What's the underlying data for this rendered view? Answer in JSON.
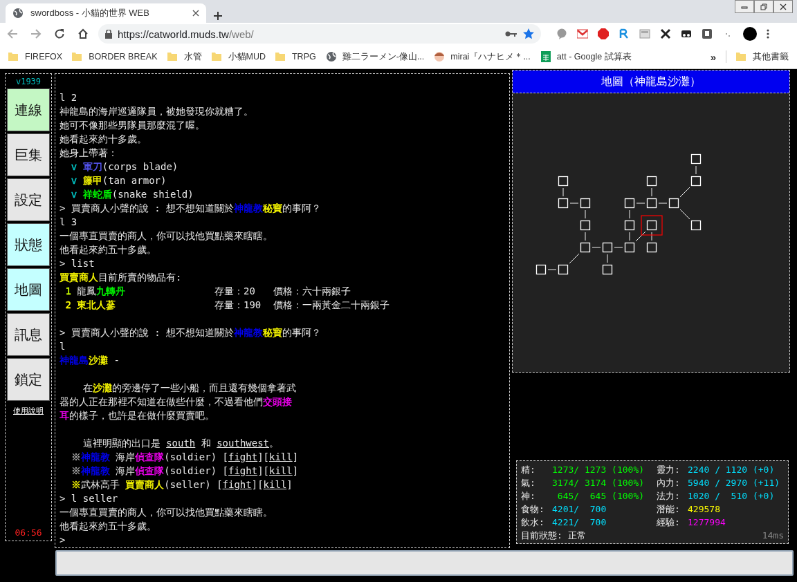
{
  "browser": {
    "tab_title": "swordboss - 小貓的世界 WEB",
    "url_host": "https://catworld.muds.tw",
    "url_path": "/web/",
    "bookmarks": [
      {
        "label": "FIREFOX",
        "kind": "folder"
      },
      {
        "label": "BORDER BREAK",
        "kind": "folder"
      },
      {
        "label": "水管",
        "kind": "folder"
      },
      {
        "label": "小貓MUD",
        "kind": "folder"
      },
      {
        "label": "TRPG",
        "kind": "folder"
      },
      {
        "label": "雞二ラーメン-像山...",
        "kind": "globe"
      },
      {
        "label": "mirai『ハナヒメ＊...",
        "kind": "avatar"
      },
      {
        "label": "att - Google 試算表",
        "kind": "sheet"
      }
    ],
    "more": "»",
    "other_bookmarks": "其他書籤"
  },
  "sidebar": {
    "version": "v1939",
    "buttons": [
      {
        "label": "連線",
        "color": "#c4f7c4"
      },
      {
        "label": "巨集",
        "color": "#e6e6e6"
      },
      {
        "label": "設定",
        "color": "#e6e6e6"
      },
      {
        "label": "狀態",
        "color": "#c4ffff"
      },
      {
        "label": "地圖",
        "color": "#c4ffff"
      },
      {
        "label": "訊息",
        "color": "#e6e6e6"
      },
      {
        "label": "鎖定",
        "color": "#e6e6e6"
      }
    ],
    "help": "使用說明",
    "clock": "06:56"
  },
  "terminal": {
    "lines": [
      {
        "kind": "text",
        "segments": [
          {
            "text": "l 2"
          }
        ]
      },
      {
        "kind": "text",
        "segments": [
          {
            "text": "神龍島的海岸巡邏隊員，被她發現你就糟了。"
          }
        ]
      },
      {
        "kind": "text",
        "segments": [
          {
            "text": "她可不像那些男隊員那麼混了喔。"
          }
        ]
      },
      {
        "kind": "text",
        "segments": [
          {
            "text": "她看起來約十多歲。"
          }
        ]
      },
      {
        "kind": "text",
        "segments": [
          {
            "text": "她身上帶著："
          }
        ]
      },
      {
        "kind": "text",
        "segments": [
          {
            "text": "  v ",
            "color": "#00c8c8"
          },
          {
            "text": "軍刀",
            "color": "#5a5aff"
          },
          {
            "text": "(corps blade)"
          }
        ]
      },
      {
        "kind": "text",
        "segments": [
          {
            "text": "  v ",
            "color": "#00c8c8"
          },
          {
            "text": "籐甲",
            "color": "#ffff00"
          },
          {
            "text": "(tan armor)"
          }
        ]
      },
      {
        "kind": "text",
        "segments": [
          {
            "text": "  v ",
            "color": "#00c8c8"
          },
          {
            "text": "祥蛇盾",
            "color": "#00ff00"
          },
          {
            "text": "(snake shield)"
          }
        ]
      },
      {
        "kind": "text",
        "segments": [
          {
            "text": "> 買賣商人小聲的說 : 想不想知道關於"
          },
          {
            "text": "神龍教",
            "color": "#0000ff"
          },
          {
            "text": "秘寶",
            "color": "#ffff00"
          },
          {
            "text": "的事阿？"
          }
        ]
      },
      {
        "kind": "text",
        "segments": [
          {
            "text": "l 3"
          }
        ]
      },
      {
        "kind": "text",
        "segments": [
          {
            "text": "一個專直買賣的商人，你可以找他買點藥來瞎瞎。"
          }
        ]
      },
      {
        "kind": "text",
        "segments": [
          {
            "text": "他看起來約五十多歲。"
          }
        ]
      },
      {
        "kind": "text",
        "segments": [
          {
            "text": "> list"
          }
        ]
      },
      {
        "kind": "text",
        "segments": [
          {
            "text": "買賣商人",
            "color": "#ffff00"
          },
          {
            "text": "目前所賣的物品有:"
          }
        ]
      },
      {
        "kind": "shop",
        "segments": [
          {
            "text": " 1 ",
            "color": "#c8ff00"
          },
          {
            "text": "龍鳳"
          },
          {
            "text": "九轉丹",
            "color": "#00ff00"
          }
        ],
        "stock": "存量：20",
        "price": "價格：六十兩銀子"
      },
      {
        "kind": "shop",
        "segments": [
          {
            "text": " 2 ",
            "color": "#ffff00"
          },
          {
            "text": "東北人蔘",
            "color": "#ffff00"
          }
        ],
        "stock": "存量：190",
        "price": "價格：一兩黃金二十兩銀子"
      },
      {
        "kind": "blank"
      },
      {
        "kind": "text",
        "segments": [
          {
            "text": "> 買賣商人小聲的說 : 想不想知道關於"
          },
          {
            "text": "神龍教",
            "color": "#0000ff"
          },
          {
            "text": "秘寶",
            "color": "#ffff00"
          },
          {
            "text": "的事阿？"
          }
        ]
      },
      {
        "kind": "text",
        "segments": [
          {
            "text": "l"
          }
        ]
      },
      {
        "kind": "text",
        "segments": [
          {
            "text": "神龍島",
            "color": "#0000ff"
          },
          {
            "text": "沙灘",
            "color": "#ffff00"
          },
          {
            "text": " -"
          }
        ]
      },
      {
        "kind": "blank"
      },
      {
        "kind": "text",
        "segments": [
          {
            "text": "    在"
          },
          {
            "text": "沙灘",
            "color": "#ffff00"
          },
          {
            "text": "的旁邊停了一些小船，而且還有幾個拿著武"
          }
        ]
      },
      {
        "kind": "text",
        "segments": [
          {
            "text": "器的人正在那裡不知道在做些什麼，不過看他們"
          },
          {
            "text": "交頭接",
            "color": "#ff00ff"
          }
        ]
      },
      {
        "kind": "text",
        "segments": [
          {
            "text": "耳",
            "color": "#ff00ff"
          },
          {
            "text": "的樣子，也許是在做什麼買賣吧。"
          }
        ]
      },
      {
        "kind": "blank"
      },
      {
        "kind": "text",
        "segments": [
          {
            "text": "    這裡明顯的出口是 "
          },
          {
            "text": "south",
            "kind": "link"
          },
          {
            "text": " 和 "
          },
          {
            "text": "southwest",
            "kind": "link"
          },
          {
            "text": "。"
          }
        ]
      },
      {
        "kind": "indented",
        "segments": [
          {
            "text": "※",
            "color": "#aaaaaa"
          },
          {
            "text": "神龍教",
            "color": "#0000ff"
          },
          {
            "text": " 海岸"
          },
          {
            "text": "偵查隊",
            "color": "#ff00ff"
          },
          {
            "text": "(soldier) ["
          },
          {
            "text": "fight",
            "kind": "link"
          },
          {
            "text": "]["
          },
          {
            "text": "kill",
            "kind": "link"
          },
          {
            "text": "]"
          }
        ]
      },
      {
        "kind": "indented",
        "segments": [
          {
            "text": "※",
            "color": "#aaaaaa"
          },
          {
            "text": "神龍教",
            "color": "#0000ff"
          },
          {
            "text": " 海岸"
          },
          {
            "text": "偵查隊",
            "color": "#ff00ff"
          },
          {
            "text": "(soldier) ["
          },
          {
            "text": "fight",
            "kind": "link"
          },
          {
            "text": "]["
          },
          {
            "text": "kill",
            "kind": "link"
          },
          {
            "text": "]"
          }
        ]
      },
      {
        "kind": "indented",
        "segments": [
          {
            "text": "※",
            "color": "#ffff00"
          },
          {
            "text": "武林高手 "
          },
          {
            "text": "買賣商人",
            "color": "#ffff00"
          },
          {
            "text": "(seller) ["
          },
          {
            "text": "fight",
            "kind": "link"
          },
          {
            "text": "]["
          },
          {
            "text": "kill",
            "kind": "link"
          },
          {
            "text": "]"
          }
        ]
      },
      {
        "kind": "text",
        "segments": [
          {
            "text": "> l seller"
          }
        ]
      },
      {
        "kind": "text",
        "segments": [
          {
            "text": "一個專直買賣的商人，你可以找他買點藥來瞎瞎。"
          }
        ]
      },
      {
        "kind": "text",
        "segments": [
          {
            "text": "他看起來約五十多歲。"
          }
        ]
      },
      {
        "kind": "text",
        "segments": [
          {
            "text": ">"
          }
        ]
      }
    ]
  },
  "map": {
    "title": "地圖（神龍島沙灘）",
    "rooms": [
      {
        "selected": false
      },
      {
        "selected": false
      },
      {
        "selected": false
      },
      {
        "selected": false
      },
      {
        "selected": false
      },
      {
        "selected": false
      },
      {
        "selected": false
      },
      {
        "selected": false
      },
      {
        "selected": false
      },
      {
        "selected": false
      },
      {
        "selected": false
      },
      {
        "selected": true
      },
      {
        "selected": false
      },
      {
        "selected": false
      },
      {
        "selected": false
      },
      {
        "selected": false
      },
      {
        "selected": false
      },
      {
        "selected": false
      },
      {
        "selected": false
      },
      {
        "selected": false
      }
    ]
  },
  "stats": {
    "items": [
      {
        "label": "精:",
        "value": "1273/ 1273 (100%)",
        "color": "#00ff00"
      },
      {
        "label": "靈力:",
        "value": "2240 / 1120 (+0)",
        "color": "#00e0ff"
      },
      {
        "label": "氣:",
        "value": "3174/ 3174 (100%)",
        "color": "#00ff00"
      },
      {
        "label": "內力:",
        "value": "5940 / 2970 (+11)",
        "color": "#00e0ff"
      },
      {
        "label": "神:",
        "value": " 645/  645 (100%)",
        "color": "#00ff00"
      },
      {
        "label": "法力:",
        "value": "1020 /  510 (+0)",
        "color": "#00e0ff"
      },
      {
        "label": "食物:",
        "value": "4201/  700",
        "color": "#00e0ff"
      },
      {
        "label": "潛能:",
        "value": "429578",
        "color": "#ffff00"
      },
      {
        "label": "飲水:",
        "value": "4221/  700",
        "color": "#00e0ff"
      },
      {
        "label": "經驗:",
        "value": "1277994",
        "color": "#ff00ff"
      }
    ],
    "status_label": "目前狀態:",
    "status_value": "正常",
    "latency": "14ms"
  }
}
